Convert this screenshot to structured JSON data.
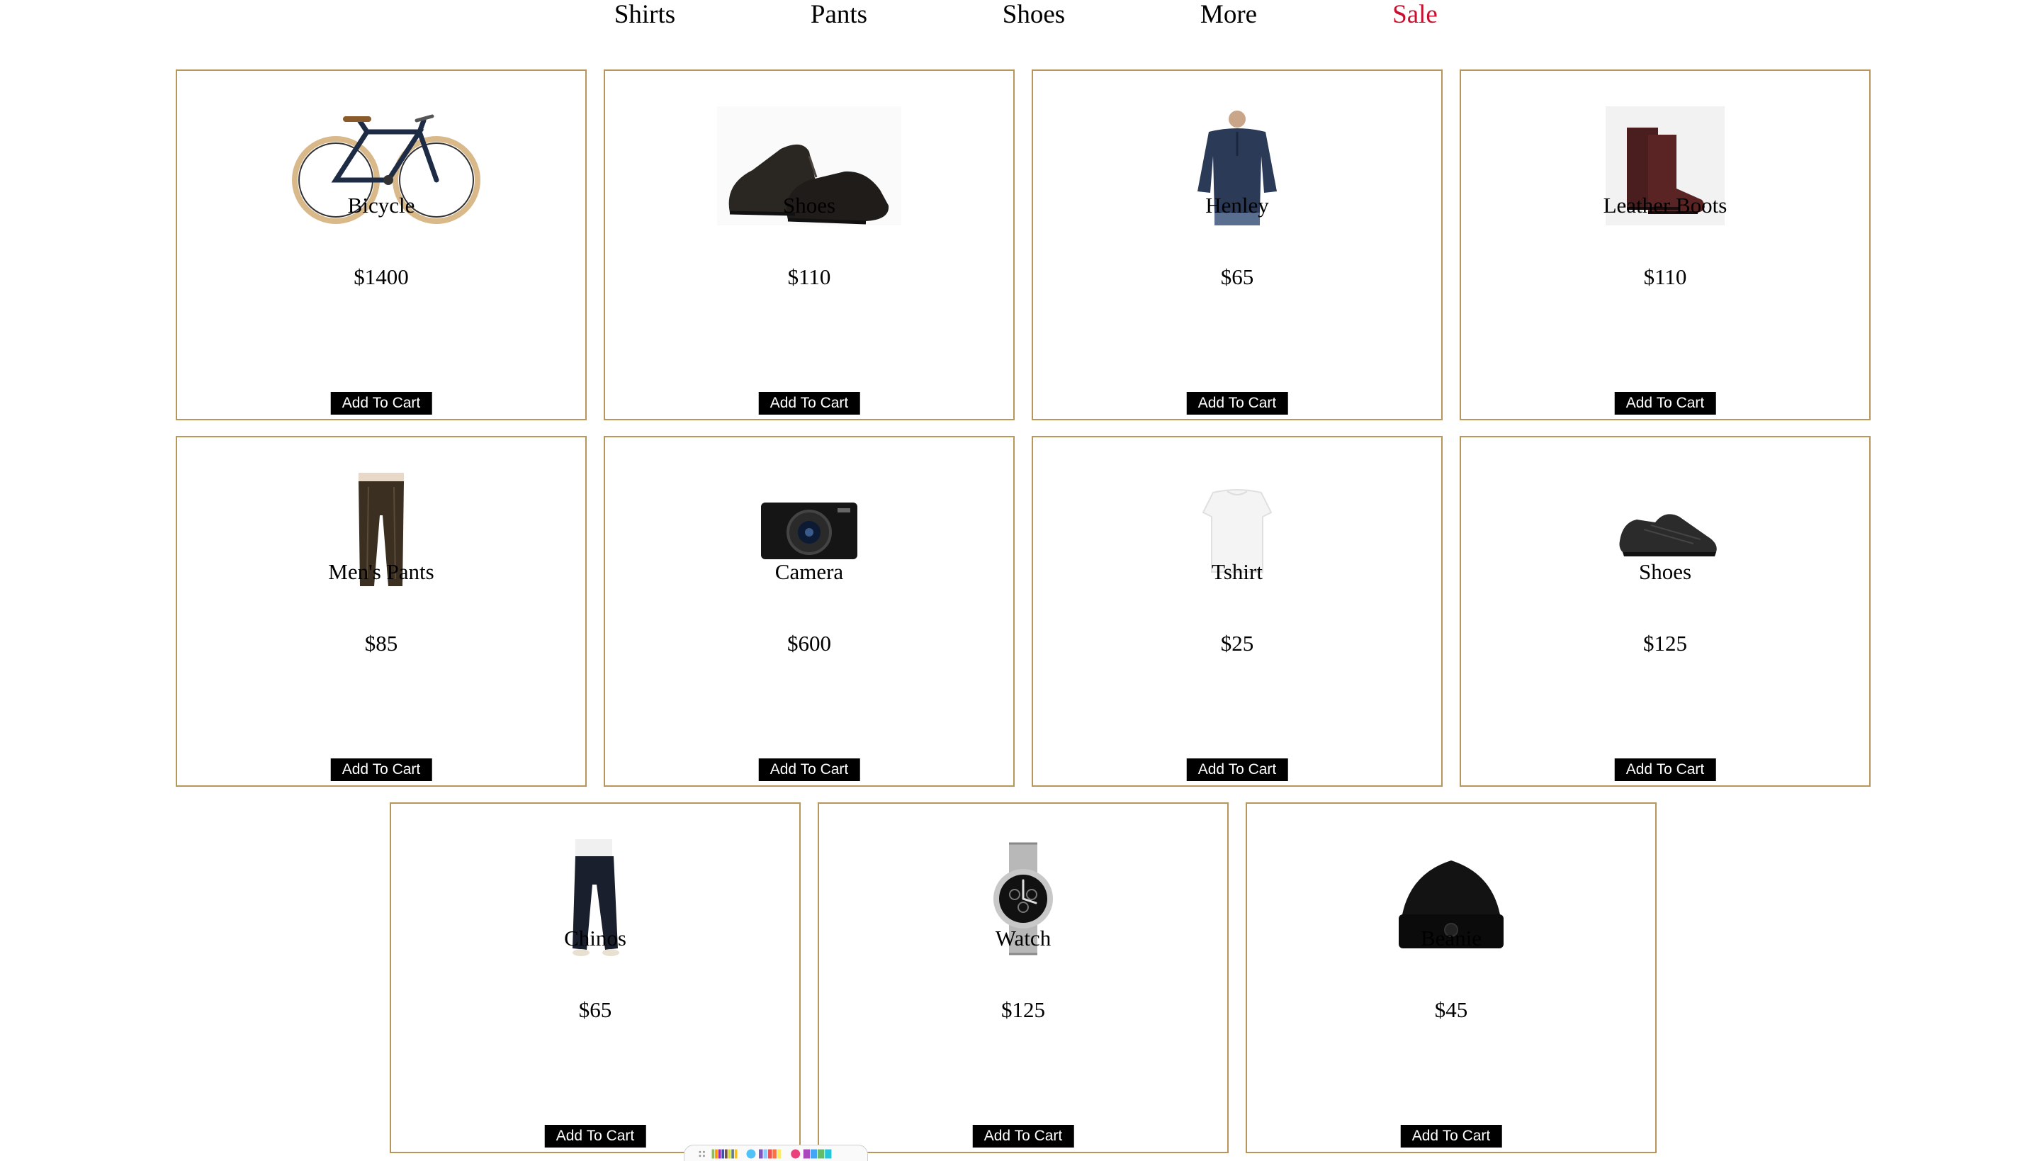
{
  "nav": {
    "items": [
      {
        "label": "Shirts"
      },
      {
        "label": "Pants"
      },
      {
        "label": "Shoes"
      },
      {
        "label": "More"
      },
      {
        "label": "Sale"
      }
    ],
    "sale_color": "#c8102e"
  },
  "theme": {
    "card_border": "#b8955a",
    "button_bg": "#000000",
    "button_fg": "#ffffff"
  },
  "products": [
    {
      "name": "Bicycle",
      "price": "$1400",
      "button": "Add To Cart",
      "icon": "bicycle-image"
    },
    {
      "name": "Shoes",
      "price": "$110",
      "button": "Add To Cart",
      "icon": "dress-shoes-image"
    },
    {
      "name": "Henley",
      "price": "$65",
      "button": "Add To Cart",
      "icon": "henley-shirt-image"
    },
    {
      "name": "Leather Boots",
      "price": "$110",
      "button": "Add To Cart",
      "icon": "leather-boots-image"
    },
    {
      "name": "Men's Pants",
      "price": "$85",
      "button": "Add To Cart",
      "icon": "leather-pants-image"
    },
    {
      "name": "Camera",
      "price": "$600",
      "button": "Add To Cart",
      "icon": "camera-image"
    },
    {
      "name": "Tshirt",
      "price": "$25",
      "button": "Add To Cart",
      "icon": "tshirt-image"
    },
    {
      "name": "Shoes",
      "price": "$125",
      "button": "Add To Cart",
      "icon": "sneaker-image"
    },
    {
      "name": "Chinos",
      "price": "$65",
      "button": "Add To Cart",
      "icon": "chinos-image"
    },
    {
      "name": "Watch",
      "price": "$125",
      "button": "Add To Cart",
      "icon": "watch-image"
    },
    {
      "name": "Beanie",
      "price": "$45",
      "button": "Add To Cart",
      "icon": "beanie-image"
    }
  ]
}
